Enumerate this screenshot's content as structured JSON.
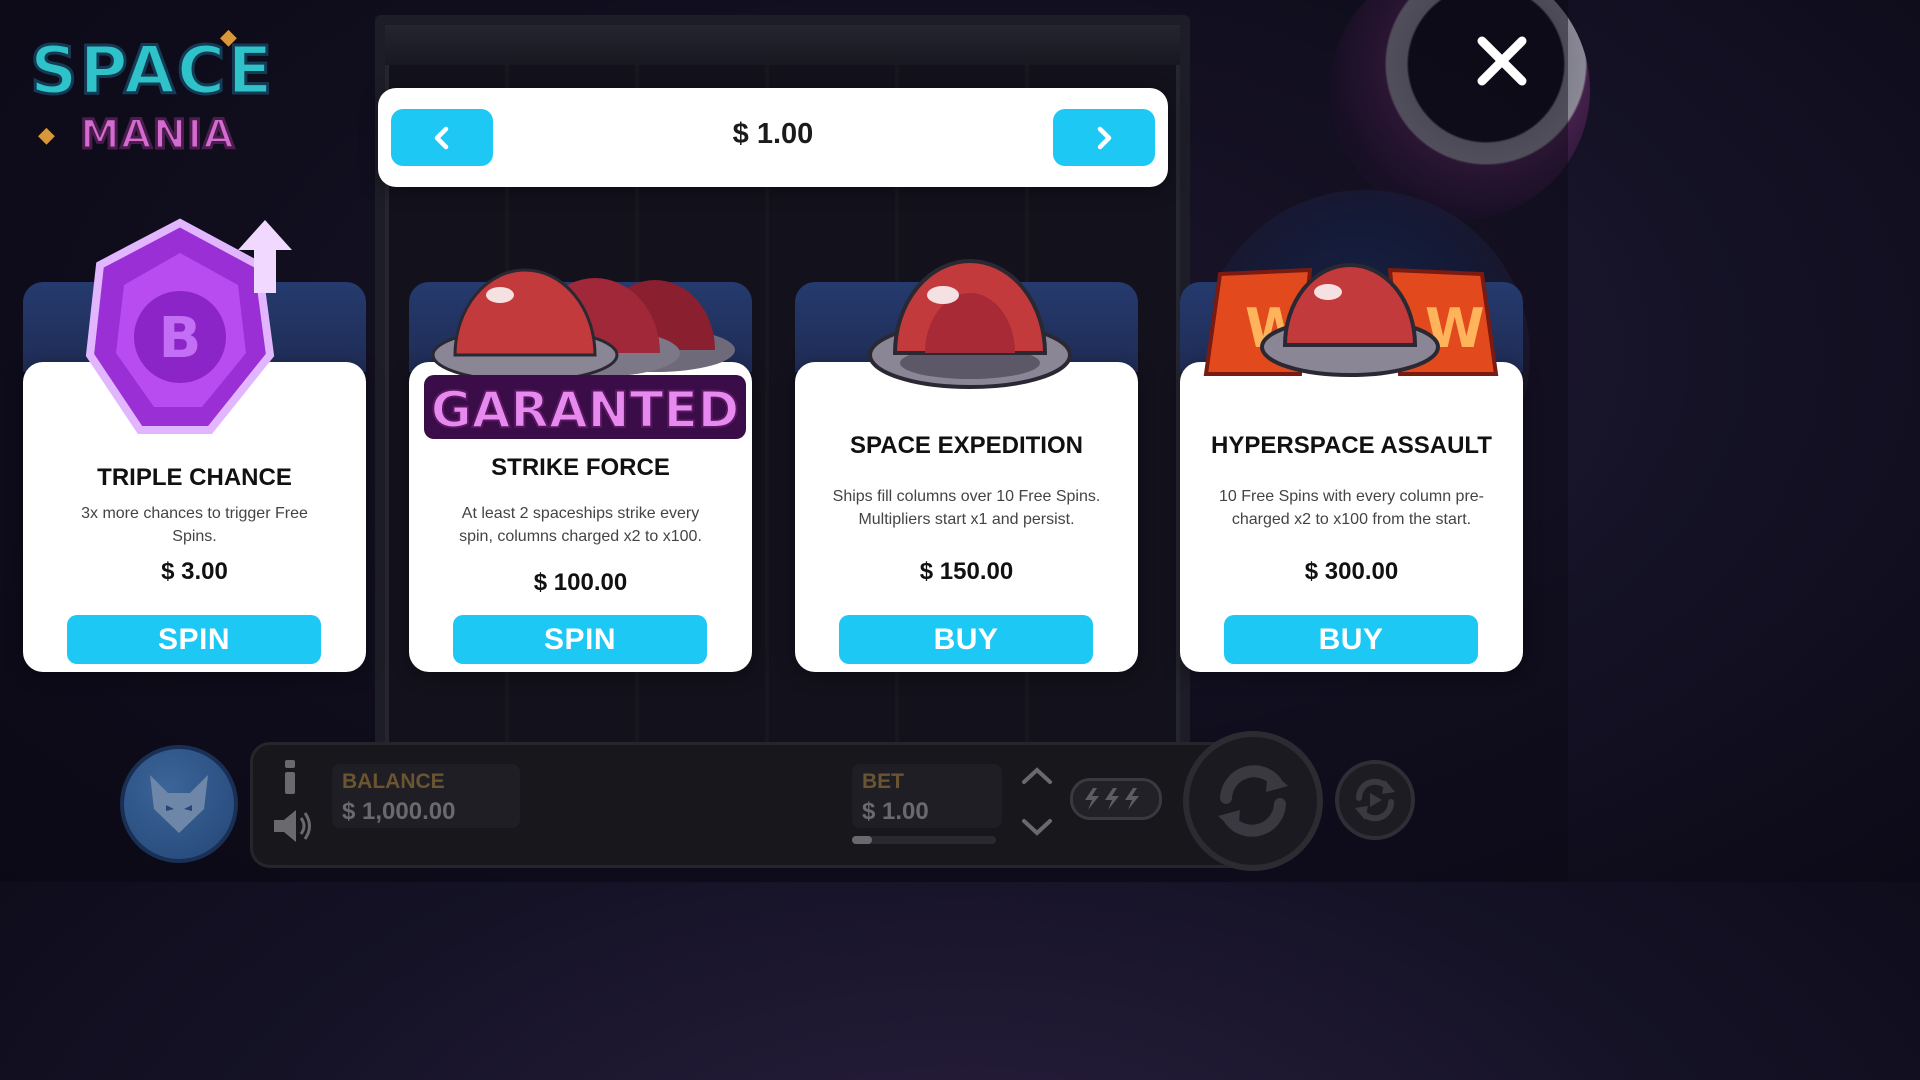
{
  "game": {
    "logo_word1": "SPACE",
    "logo_word2": "MANIA"
  },
  "bet_selector": {
    "value": "$ 1.00",
    "prev_icon": "chevron-left-icon",
    "next_icon": "chevron-right-icon"
  },
  "close_icon": "close-icon",
  "cards": [
    {
      "title": "TRIPLE CHANCE",
      "description": "3x more chances to trigger Free Spins.",
      "price": "$ 3.00",
      "button": "SPIN",
      "art": "bonus-badge-icon"
    },
    {
      "title": "STRIKE FORCE",
      "badge_text": "GARANTED",
      "description": "At least 2 spaceships strike every spin, columns charged x2 to x100.",
      "price": "$ 100.00",
      "button": "SPIN",
      "art": "triple-spaceship-icon"
    },
    {
      "title": "SPACE EXPEDITION",
      "description": "Ships fill columns over 10 Free Spins. Multipliers start x1 and persist.",
      "price": "$ 150.00",
      "button": "BUY",
      "art": "spaceship-icon"
    },
    {
      "title": "HYPERSPACE ASSAULT",
      "description": "10 Free Spins with every column pre-charged x2 to x100 from the start.",
      "price": "$ 300.00",
      "button": "BUY",
      "art": "spaceship-wild-icon"
    }
  ],
  "bottom_bar": {
    "balance_label": "BALANCE",
    "balance_value": "$ 1,000.00",
    "bet_label": "BET",
    "bet_value": "$ 1.00",
    "bet_level_fraction": 0.14
  },
  "colors": {
    "accent": "#1ec8f5",
    "card_bg": "#ffffff",
    "text_dark": "#111111",
    "badge_purple": "#b23fe0"
  }
}
